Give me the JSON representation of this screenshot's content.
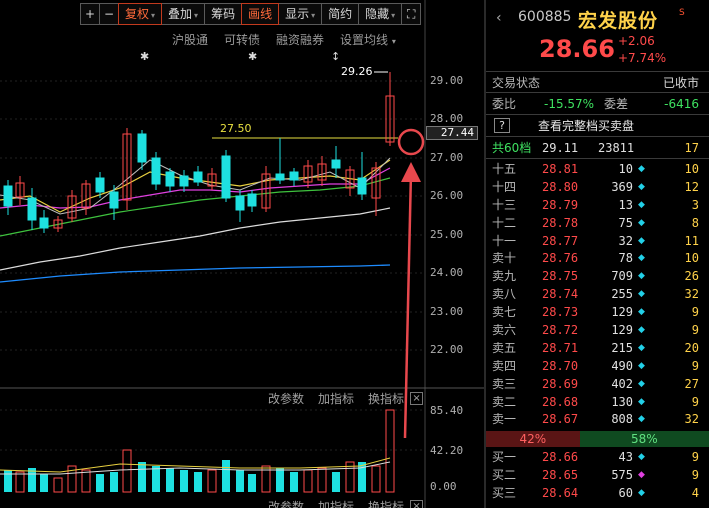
{
  "toolbar": {
    "buttons": [
      {
        "label": "+"
      },
      {
        "label": "−"
      },
      {
        "label": "复权",
        "active": true,
        "caret": true
      },
      {
        "label": "叠加",
        "caret": true
      },
      {
        "label": "筹码"
      },
      {
        "label": "画线",
        "active": true
      },
      {
        "label": "显示",
        "caret": true
      },
      {
        "label": "简约"
      },
      {
        "label": "隐藏",
        "caret": true
      },
      {
        "label": "⛶"
      }
    ]
  },
  "sublinks": [
    "沪股通",
    "可转债",
    "融资融券",
    "设置均线"
  ],
  "sublink_caret": "▾",
  "price_axis": [
    "29.00",
    "28.00",
    "27.00",
    "26.00",
    "25.00",
    "24.00",
    "23.00",
    "22.00"
  ],
  "current_price_label": "27.44",
  "high_label": "29.26",
  "ref_line_label": "27.50",
  "volume_axis": [
    "85.40",
    "42.20",
    "0.00"
  ],
  "param_row": {
    "params": "改参数",
    "indicators": "加指标",
    "switch": "换指标",
    "close": "×"
  },
  "stock": {
    "nav": "‹",
    "code": "600885",
    "name": "宏发股份",
    "badge": "S",
    "price": "28.66",
    "change": "+2.06",
    "change_pct": "+7.74%"
  },
  "status": {
    "label": "交易状态",
    "value": "已收市"
  },
  "ratio": {
    "label1": "委比",
    "value1": "-15.57%",
    "label2": "委差",
    "value2": "-6416"
  },
  "full_book": {
    "icon": "?",
    "label": "查看完整档买卖盘"
  },
  "levels_header": {
    "label": "共60档",
    "price": "29.11",
    "volume": "23811",
    "orders": "17"
  },
  "sell_levels": [
    {
      "level": "十五",
      "price": "28.81",
      "volume": "10",
      "dot": "◆",
      "orders": "10"
    },
    {
      "level": "十四",
      "price": "28.80",
      "volume": "369",
      "dot": "◆",
      "orders": "12"
    },
    {
      "level": "十三",
      "price": "28.79",
      "volume": "13",
      "dot": "◆",
      "orders": "3"
    },
    {
      "level": "十二",
      "price": "28.78",
      "volume": "75",
      "dot": "◆",
      "orders": "8"
    },
    {
      "level": "十一",
      "price": "28.77",
      "volume": "32",
      "dot": "◆",
      "orders": "11"
    },
    {
      "level": "卖十",
      "price": "28.76",
      "volume": "78",
      "dot": "◆",
      "orders": "10"
    },
    {
      "level": "卖九",
      "price": "28.75",
      "volume": "709",
      "dot": "◆",
      "orders": "26"
    },
    {
      "level": "卖八",
      "price": "28.74",
      "volume": "255",
      "dot": "◆",
      "orders": "32"
    },
    {
      "level": "卖七",
      "price": "28.73",
      "volume": "129",
      "dot": "◆",
      "orders": "9"
    },
    {
      "level": "卖六",
      "price": "28.72",
      "volume": "129",
      "dot": "◆",
      "orders": "9"
    },
    {
      "level": "卖五",
      "price": "28.71",
      "volume": "215",
      "dot": "◆",
      "orders": "20"
    },
    {
      "level": "卖四",
      "price": "28.70",
      "volume": "490",
      "dot": "◆",
      "orders": "9"
    },
    {
      "level": "卖三",
      "price": "28.69",
      "volume": "402",
      "dot": "◆",
      "orders": "27"
    },
    {
      "level": "卖二",
      "price": "28.68",
      "volume": "130",
      "dot": "◆",
      "orders": "9"
    },
    {
      "level": "卖一",
      "price": "28.67",
      "volume": "808",
      "dot": "◆",
      "orders": "32"
    }
  ],
  "ratio_bar": {
    "sell_pct": "42%",
    "buy_pct": "58%",
    "sell_fraction": 0.42
  },
  "buy_levels": [
    {
      "level": "买一",
      "price": "28.66",
      "volume": "43",
      "dot": "◆",
      "orders": "9"
    },
    {
      "level": "买二",
      "price": "28.65",
      "volume": "575",
      "dot": "◆",
      "orders": "9"
    },
    {
      "level": "买三",
      "price": "28.64",
      "volume": "60",
      "dot": "◆",
      "orders": "4"
    }
  ],
  "colors": {
    "up": "#ff4a4a",
    "down": "#1ee0e0",
    "accent": "#ffd24a",
    "annotation": "#e8484d"
  }
}
